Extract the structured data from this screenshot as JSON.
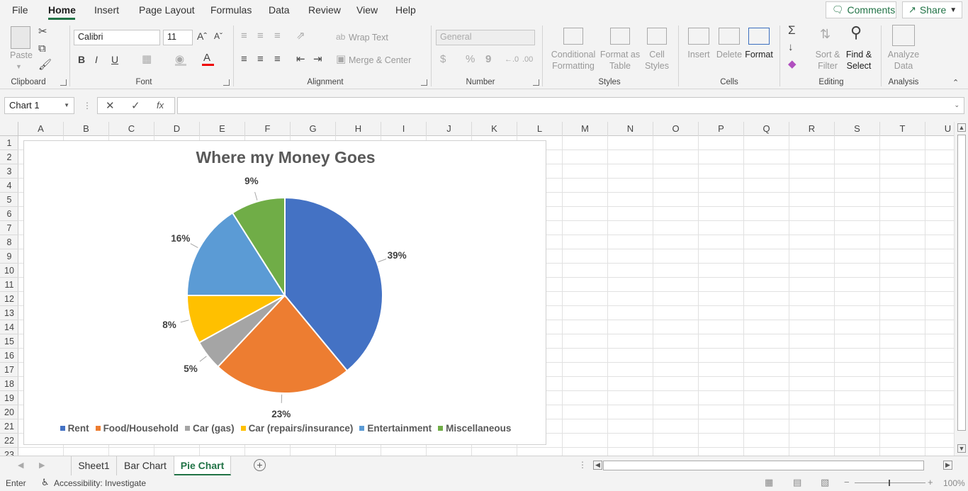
{
  "menu": {
    "items": [
      "File",
      "Home",
      "Insert",
      "Page Layout",
      "Formulas",
      "Data",
      "Review",
      "View",
      "Help"
    ],
    "active": "Home",
    "comments_label": "Comments",
    "share_label": "Share"
  },
  "ribbon": {
    "clipboard": {
      "paste": "Paste",
      "group": "Clipboard"
    },
    "font": {
      "name": "Calibri",
      "size": "11",
      "group": "Font",
      "bold": "B",
      "italic": "I",
      "underline": "U",
      "font_color": "A"
    },
    "alignment": {
      "wrap_text": "Wrap Text",
      "merge_center": "Merge & Center",
      "group": "Alignment"
    },
    "number": {
      "format": "General",
      "currency": "$",
      "percent": "%",
      "comma": "9",
      "group": "Number"
    },
    "styles": {
      "conditional_1": "Conditional",
      "conditional_2": "Formatting",
      "format_table_1": "Format as",
      "format_table_2": "Table",
      "cell_styles_1": "Cell",
      "cell_styles_2": "Styles",
      "group": "Styles"
    },
    "cells": {
      "insert": "Insert",
      "delete": "Delete",
      "format": "Format",
      "group": "Cells"
    },
    "editing": {
      "sum": "Σ",
      "sort_1": "Sort &",
      "sort_2": "Filter",
      "find_1": "Find &",
      "find_2": "Select",
      "group": "Editing"
    },
    "analysis": {
      "analyze_1": "Analyze",
      "analyze_2": "Data",
      "group": "Analysis"
    }
  },
  "formula_bar": {
    "name_box": "Chart 1",
    "fx": "fx",
    "value": ""
  },
  "columns": [
    "A",
    "B",
    "C",
    "D",
    "E",
    "F",
    "G",
    "H",
    "I",
    "J",
    "K",
    "L",
    "M",
    "N",
    "O",
    "P",
    "Q",
    "R",
    "S",
    "T",
    "U"
  ],
  "rows": [
    "1",
    "2",
    "3",
    "4",
    "5",
    "6",
    "7",
    "8",
    "9",
    "10",
    "11",
    "12",
    "13",
    "14",
    "15",
    "16",
    "17",
    "18",
    "19",
    "20",
    "21",
    "22",
    "23"
  ],
  "chart_data": {
    "type": "pie",
    "title": "Where my Money Goes",
    "categories": [
      "Rent",
      "Food/Household",
      "Car (gas)",
      "Car (repairs/insurance)",
      "Entertainment",
      "Miscellaneous"
    ],
    "values": [
      39,
      23,
      5,
      8,
      16,
      9
    ],
    "labels": [
      "39%",
      "23%",
      "5%",
      "8%",
      "16%",
      "9%"
    ],
    "colors": [
      "#4472c4",
      "#ed7d31",
      "#a5a5a5",
      "#ffc000",
      "#5b9bd5",
      "#70ad47"
    ],
    "legend_position": "bottom"
  },
  "sheets": {
    "tabs": [
      "Sheet1",
      "Bar Chart",
      "Pie Chart"
    ],
    "active": "Pie Chart"
  },
  "status": {
    "mode": "Enter",
    "accessibility": "Accessibility: Investigate",
    "zoom": "100%"
  }
}
